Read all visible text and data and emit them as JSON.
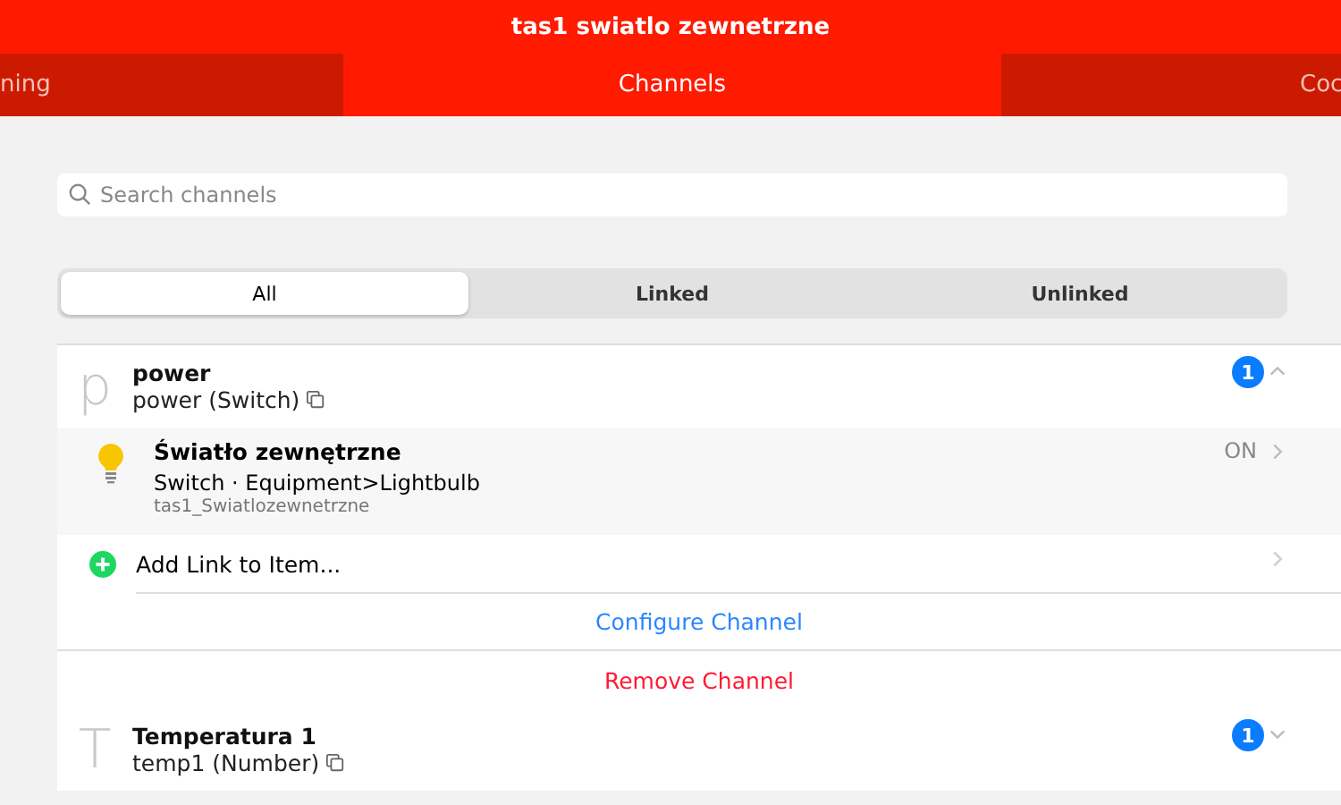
{
  "header": {
    "title": "tas1 swiatlo zewnetrzne"
  },
  "tabs": [
    {
      "label": "ning",
      "selected": false
    },
    {
      "label": "Channels",
      "selected": true
    },
    {
      "label": "Coc",
      "selected": false
    }
  ],
  "search": {
    "placeholder": "Search channels"
  },
  "filter": [
    {
      "label": "All",
      "selected": true
    },
    {
      "label": "Linked",
      "selected": false
    },
    {
      "label": "Unlinked",
      "selected": false
    }
  ],
  "channels": [
    {
      "letter": "p",
      "name": "power",
      "type_label": "power (Switch)",
      "count": "1",
      "expanded": true,
      "links": [
        {
          "name": "Światło zewnętrzne",
          "detail": "Switch · Equipment>Lightbulb",
          "item": "tas1_Swiatlozewnetrzne",
          "state": "ON"
        }
      ],
      "add_link": "Add Link to Item...",
      "configure": "Configure Channel",
      "remove": "Remove Channel"
    },
    {
      "letter": "T",
      "name": "Temperatura 1",
      "type_label": "temp1 (Number)",
      "count": "1",
      "expanded": false
    }
  ]
}
